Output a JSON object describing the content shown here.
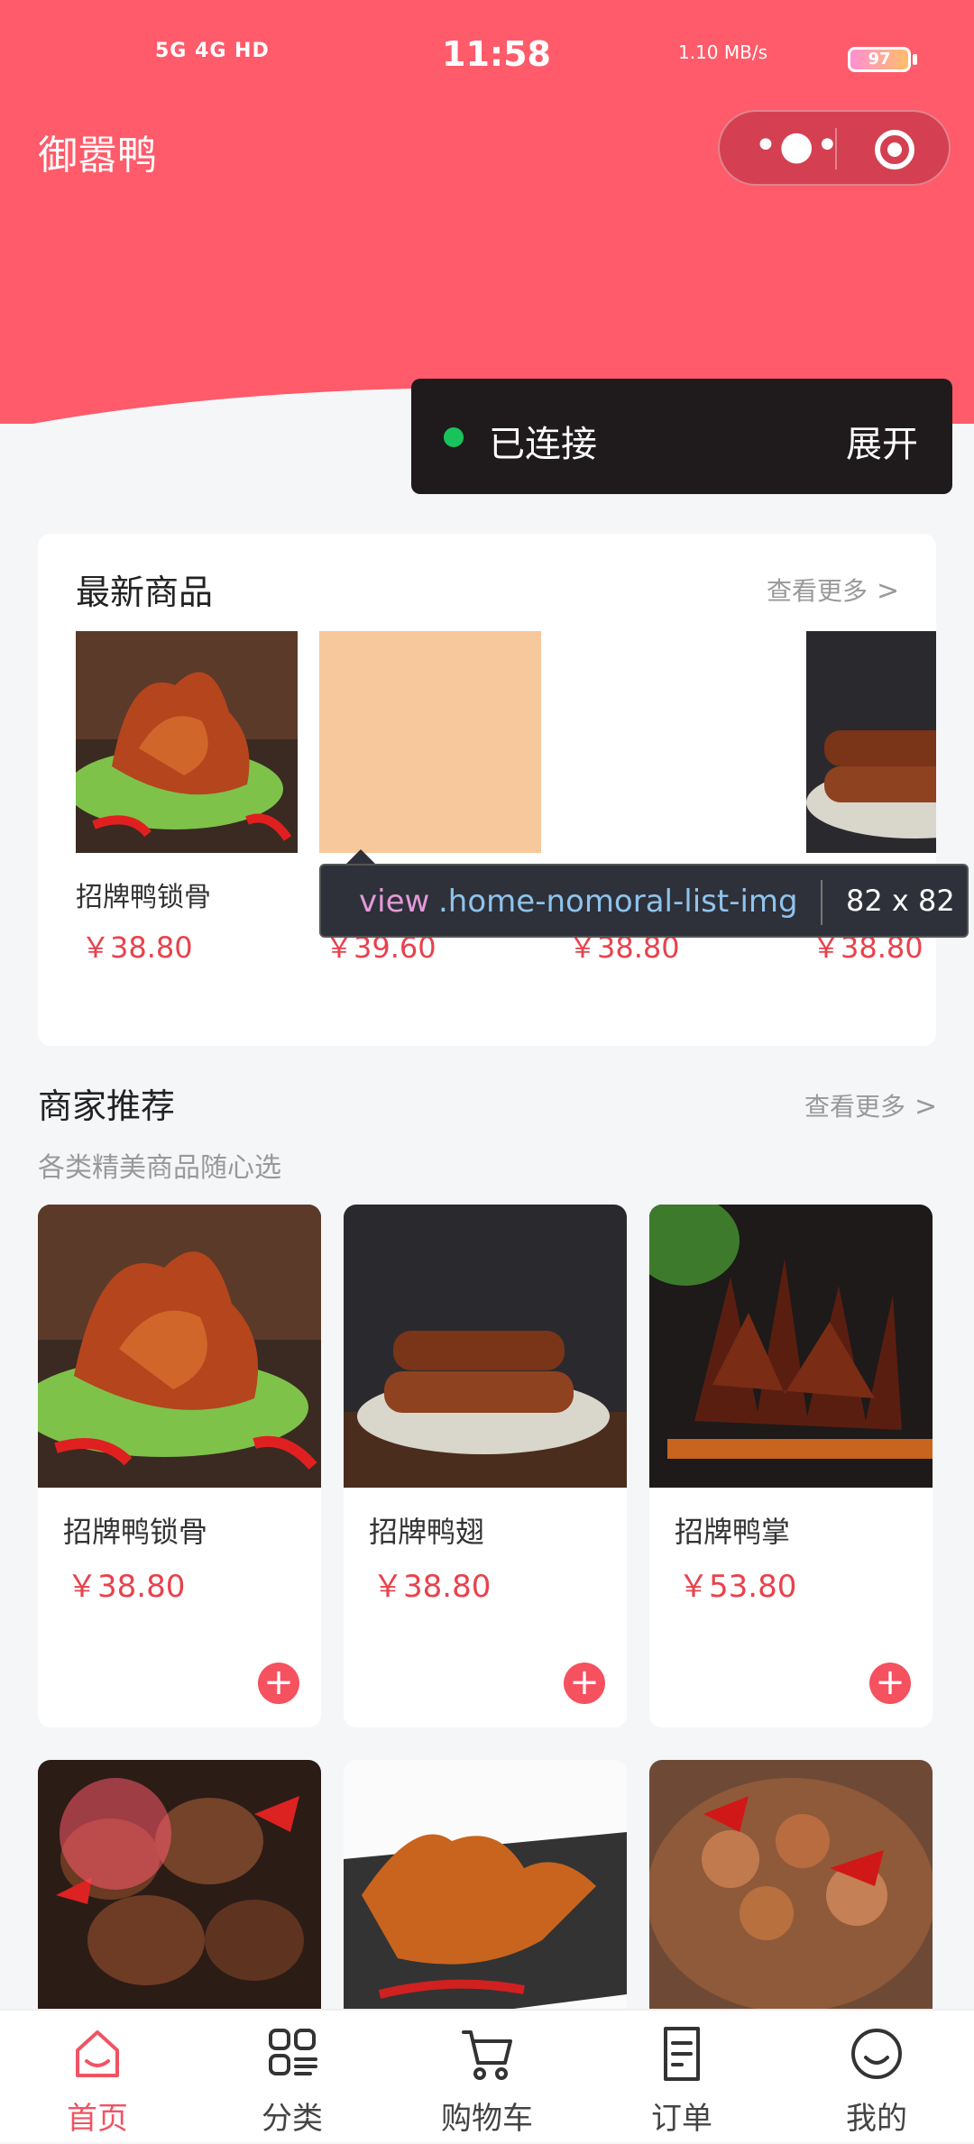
{
  "status_bar": {
    "time": "11:58",
    "network_left": "5G  4G  HD",
    "speed": "1.10 MB/s",
    "battery": "97"
  },
  "header": {
    "app_title": "御嚣鸭",
    "menu_icon": "more-dots-icon",
    "close_icon": "target-circle-icon",
    "brand_color": "#ff5b6a"
  },
  "connection": {
    "status": "已连接",
    "expand_label": "展开",
    "dot_color": "#19c35b"
  },
  "newest": {
    "title": "最新商品",
    "more": "查看更多",
    "items": [
      {
        "name": "招牌鸭锁骨",
        "price": "￥38.80"
      },
      {
        "name": "",
        "price": "￥39.60"
      },
      {
        "name": "",
        "price": "￥38.80"
      },
      {
        "name": "",
        "price": "￥38.80"
      }
    ]
  },
  "inspector_tooltip": {
    "tag": "view",
    "class_name": ".home-nomoral-list-img",
    "size": "82 x 82"
  },
  "recommend": {
    "title": "商家推荐",
    "subtitle": "各类精美商品随心选",
    "more": "查看更多",
    "items": [
      {
        "name": "招牌鸭锁骨",
        "price": "￥38.80"
      },
      {
        "name": "招牌鸭翅",
        "price": "￥38.80"
      },
      {
        "name": "招牌鸭掌",
        "price": "￥53.80"
      }
    ]
  },
  "tabbar": {
    "items": [
      {
        "label": "首页",
        "icon": "home-icon",
        "active": true
      },
      {
        "label": "分类",
        "icon": "category-icon",
        "active": false
      },
      {
        "label": "购物车",
        "icon": "cart-icon",
        "active": false
      },
      {
        "label": "订单",
        "icon": "order-icon",
        "active": false
      },
      {
        "label": "我的",
        "icon": "profile-icon",
        "active": false
      }
    ],
    "active_color": "#f05363"
  }
}
